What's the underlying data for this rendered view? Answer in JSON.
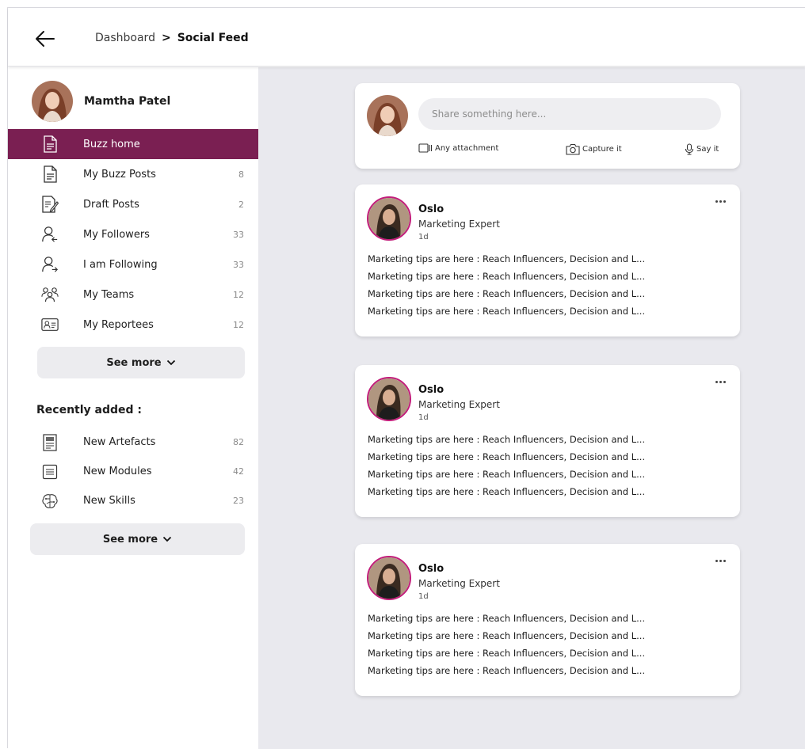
{
  "header": {
    "breadcrumb_parent": "Dashboard",
    "breadcrumb_separator": ">",
    "breadcrumb_current": "Social Feed"
  },
  "profile": {
    "name": "Mamtha Patel"
  },
  "nav": [
    {
      "label": "Buzz home",
      "count": "",
      "icon": "document-icon",
      "active": true
    },
    {
      "label": "My Buzz Posts",
      "count": "8",
      "icon": "document-icon"
    },
    {
      "label": "Draft Posts",
      "count": "2",
      "icon": "draft-edit-icon"
    },
    {
      "label": "My Followers",
      "count": "33",
      "icon": "user-follower-icon"
    },
    {
      "label": "I am Following",
      "count": "33",
      "icon": "user-following-icon"
    },
    {
      "label": "My Teams",
      "count": "12",
      "icon": "team-icon"
    },
    {
      "label": "My Reportees",
      "count": "12",
      "icon": "id-card-icon"
    }
  ],
  "see_more_label": "See more",
  "recent": {
    "title": "Recently added :",
    "items": [
      {
        "label": "New Artefacts",
        "count": "82",
        "icon": "artefact-icon"
      },
      {
        "label": "New Modules",
        "count": "42",
        "icon": "module-icon"
      },
      {
        "label": "New Skills",
        "count": "23",
        "icon": "brain-skill-icon"
      }
    ]
  },
  "composer": {
    "placeholder": "Share something here...",
    "attachment_label": "Any attachment",
    "capture_label": "Capture it",
    "say_label": "Say it"
  },
  "posts": [
    {
      "author": "Oslo",
      "role": "Marketing Expert",
      "time": "1d",
      "lines": [
        "Marketing tips are here : Reach Influencers, Decision and L...",
        "Marketing tips are here : Reach Influencers, Decision and L...",
        "Marketing tips are here : Reach Influencers, Decision and L...",
        "Marketing tips are here : Reach Influencers, Decision and L..."
      ]
    },
    {
      "author": "Oslo",
      "role": "Marketing Expert",
      "time": "1d",
      "lines": [
        "Marketing tips are here : Reach Influencers, Decision and L...",
        "Marketing tips are here : Reach Influencers, Decision and L...",
        "Marketing tips are here : Reach Influencers, Decision and L...",
        "Marketing tips are here : Reach Influencers, Decision and L..."
      ]
    },
    {
      "author": "Oslo",
      "role": "Marketing Expert",
      "time": "1d",
      "lines": [
        "Marketing tips are here : Reach Influencers, Decision and L...",
        "Marketing tips are here : Reach Influencers, Decision and L...",
        "Marketing tips are here : Reach Influencers, Decision and L...",
        "Marketing tips are here : Reach Influencers, Decision and L..."
      ]
    }
  ],
  "colors": {
    "accent": "#7a1f52",
    "avatar_ring": "#c21d7a",
    "feed_background": "#e9e9ee"
  }
}
